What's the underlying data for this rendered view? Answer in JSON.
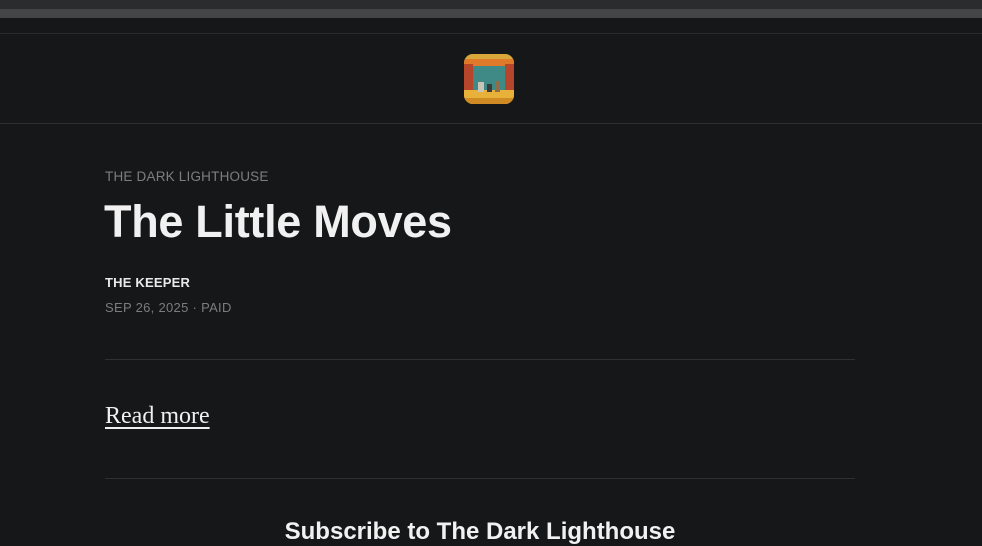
{
  "publication": {
    "name": "THE DARK LIGHTHOUSE",
    "logo_icon": "theater-stage-logo"
  },
  "post": {
    "title": "The Little Moves",
    "author": "THE KEEPER",
    "date": "SEP 26, 2025",
    "access": "PAID",
    "meta_separator": "·"
  },
  "actions": {
    "read_more": "Read more"
  },
  "subscribe": {
    "heading": "Subscribe to The Dark Lighthouse"
  },
  "colors": {
    "background": "#161718",
    "text_primary": "#f1f1f1",
    "text_muted": "#7d7e80"
  }
}
